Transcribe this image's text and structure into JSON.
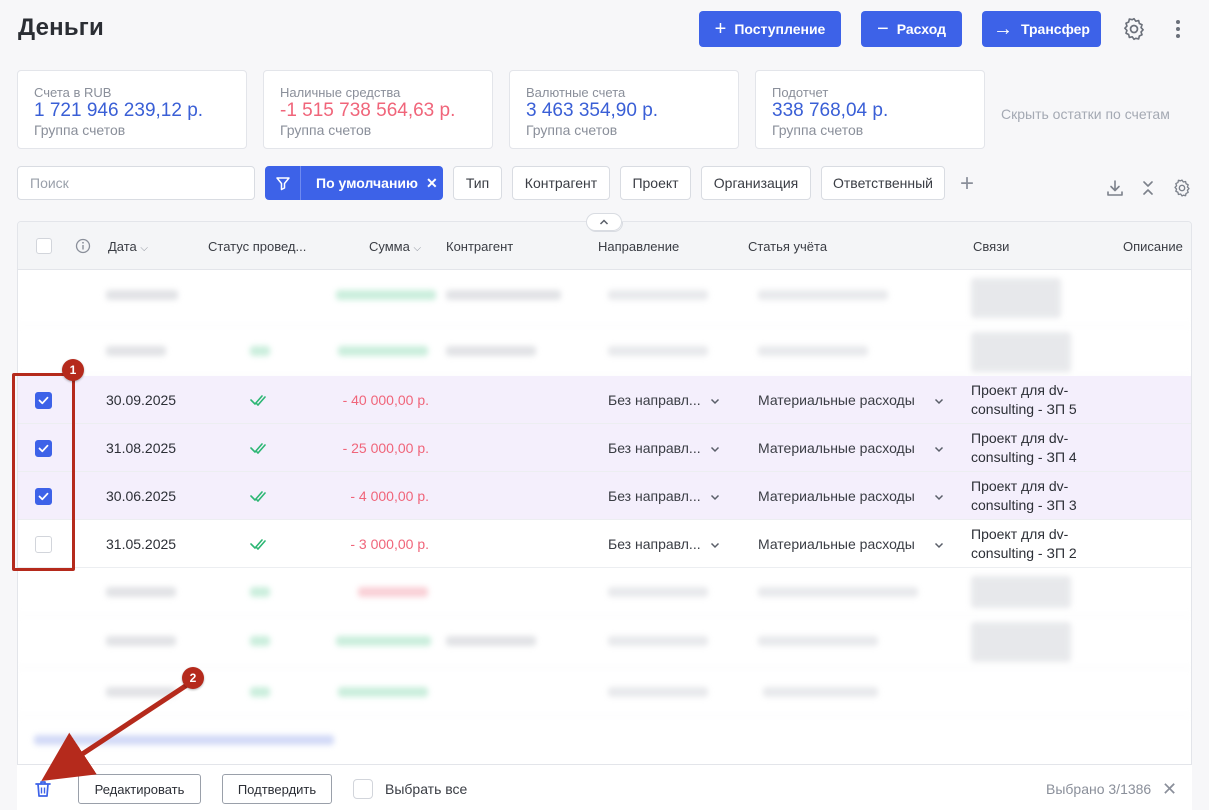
{
  "header": {
    "title": "Деньги",
    "btn_income": "Поступление",
    "btn_expense": "Расход",
    "btn_transfer": "Трансфер"
  },
  "cards": [
    {
      "label": "Счета в RUB",
      "amount": "1 721 946 239,12 р.",
      "group": "Группа счетов",
      "negative": false
    },
    {
      "label": "Наличные средства",
      "amount": "-1 515 738 564,63 р.",
      "group": "Группа счетов",
      "negative": true
    },
    {
      "label": "Валютные счета",
      "amount": "3 463 354,90 р.",
      "group": "Группа счетов",
      "negative": false
    },
    {
      "label": "Подотчет",
      "amount": "338 768,04 р.",
      "group": "Группа счетов",
      "negative": false
    }
  ],
  "hide_balances": "Скрыть остатки по счетам",
  "filters": {
    "search_placeholder": "Поиск",
    "preset": "По умолчанию",
    "chips": [
      "Тип",
      "Контрагент",
      "Проект",
      "Организация",
      "Ответственный"
    ]
  },
  "columns": {
    "date": "Дата",
    "status": "Статус провед...",
    "amount": "Сумма",
    "counterparty": "Контрагент",
    "direction": "Направление",
    "article": "Статья учёта",
    "links": "Связи",
    "description": "Описание"
  },
  "rows": [
    {
      "date": "30.09.2025",
      "amount": "- 40 000,00 р.",
      "direction": "Без направл...",
      "article": "Материальные расходы",
      "link": "Проект для dv-consulting - ЗП 5",
      "checked": true
    },
    {
      "date": "31.08.2025",
      "amount": "- 25 000,00 р.",
      "direction": "Без направл...",
      "article": "Материальные расходы",
      "link": "Проект для dv-consulting - ЗП 4",
      "checked": true
    },
    {
      "date": "30.06.2025",
      "amount": "- 4 000,00 р.",
      "direction": "Без направл...",
      "article": "Материальные расходы",
      "link": "Проект для dv-consulting - ЗП 3",
      "checked": true
    },
    {
      "date": "31.05.2025",
      "amount": "- 3 000,00 р.",
      "direction": "Без направл...",
      "article": "Материальные расходы",
      "link": "Проект для dv-consulting - ЗП 2",
      "checked": false
    }
  ],
  "footer": {
    "edit": "Редактировать",
    "confirm": "Подтвердить",
    "select_all": "Выбрать все",
    "selected": "Выбрано 3/1386"
  },
  "annotations": {
    "box_label": "1",
    "arrow_label": "2",
    "color": "#b52a1c"
  },
  "colors": {
    "accent": "#3d62e8",
    "negative": "#f0657a",
    "selected_row": "#f4effc",
    "status_ok": "#2bb673"
  }
}
